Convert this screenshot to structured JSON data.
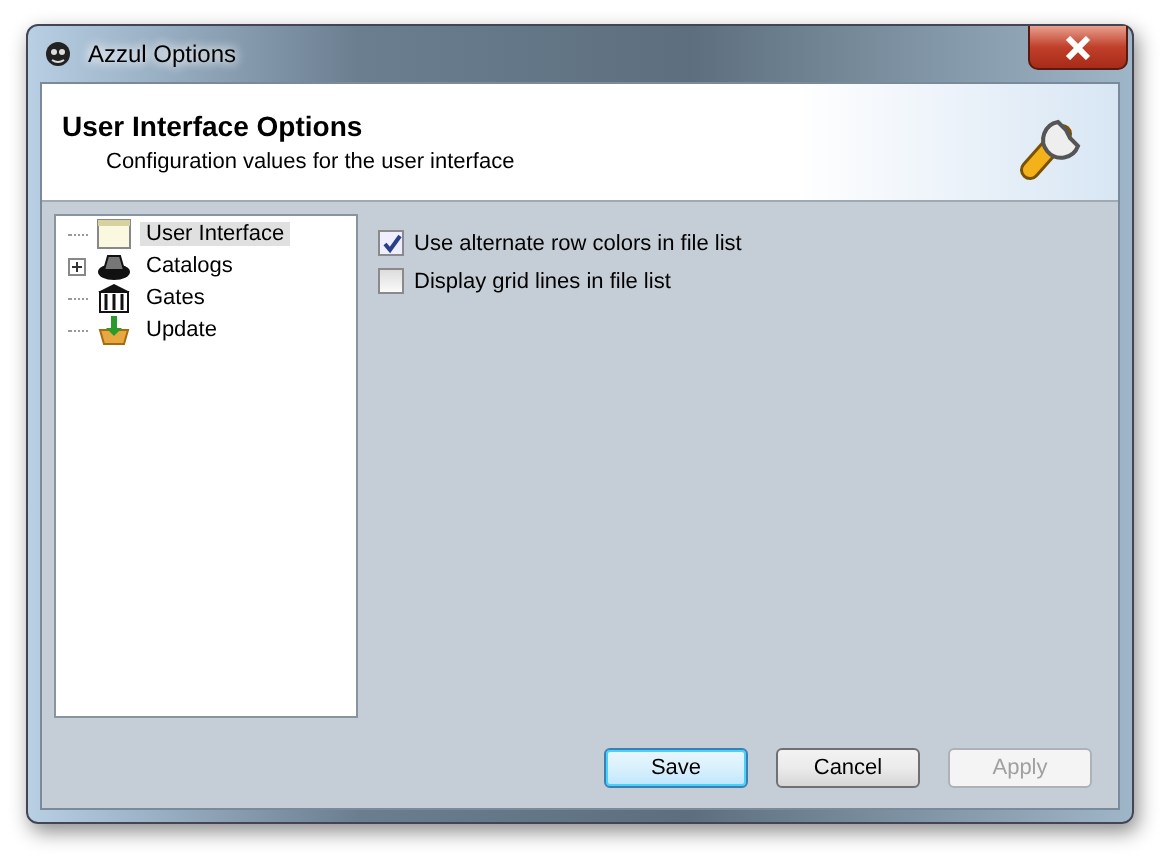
{
  "window": {
    "title": "Azzul Options"
  },
  "header": {
    "title": "User Interface Options",
    "subtitle": "Configuration values for the user interface"
  },
  "tree": {
    "items": [
      {
        "label": "User Interface",
        "selected": true
      },
      {
        "label": "Catalogs",
        "selected": false,
        "expanded": false
      },
      {
        "label": "Gates",
        "selected": false
      },
      {
        "label": "Update",
        "selected": false
      }
    ]
  },
  "options": [
    {
      "label": "Use alternate row colors in file list",
      "checked": true
    },
    {
      "label": "Display grid lines in file list",
      "checked": false
    }
  ],
  "buttons": [
    {
      "label": "Save",
      "default": true,
      "disabled": false
    },
    {
      "label": "Cancel",
      "default": false,
      "disabled": false
    },
    {
      "label": "Apply",
      "default": false,
      "disabled": true
    }
  ]
}
